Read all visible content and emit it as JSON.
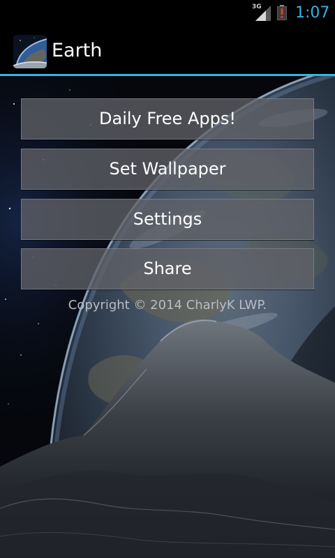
{
  "status_bar": {
    "network": "3G",
    "time": "1:07",
    "icons": [
      "signal-icon",
      "battery-alert-icon"
    ]
  },
  "action_bar": {
    "title": "Earth",
    "icon": "earth-app-icon",
    "accent_color": "#33b5e5"
  },
  "menu": {
    "buttons": [
      {
        "label": "Daily Free Apps!"
      },
      {
        "label": "Set Wallpaper"
      },
      {
        "label": "Settings"
      },
      {
        "label": "Share"
      }
    ]
  },
  "footer": {
    "copyright": "Copyright © 2014 CharlyK LWP."
  }
}
